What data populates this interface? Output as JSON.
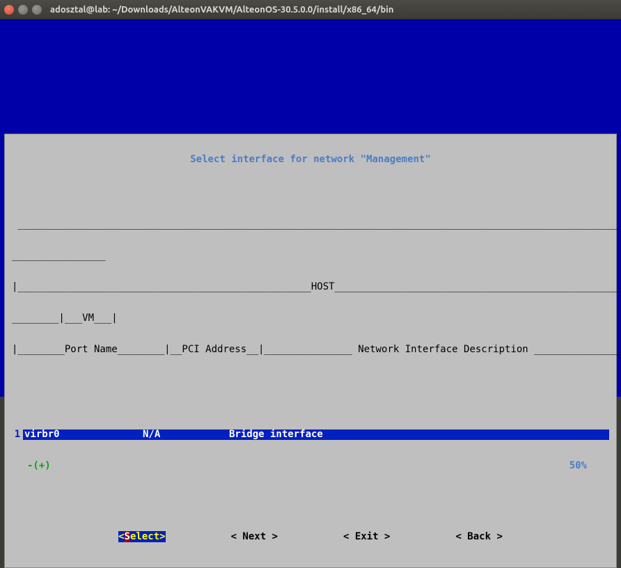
{
  "window": {
    "title": "adosztal@lab: ~/Downloads/AlteonVAKVM/AlteonOS-30.5.0.0/install/x86_64/bin"
  },
  "dialog": {
    "title": " Select interface for network \"Management\" ",
    "header_line1": " ________________________________________________________________________________________________________________",
    "header_line2": "________________",
    "header_host": "|__________________________________________________HOST__________________________________________________________",
    "header_vm": "________|___VM___|",
    "header_cols": "|________Port Name________|__PCI Address__|_______________ Network Interface Description ______________________________|__NUMA__|__Port__|",
    "row": {
      "num": "1",
      "port_name": "virbr0",
      "pci": "N/A",
      "desc": "Bridge interface"
    },
    "plusminus": "-(+)",
    "pct": "50%",
    "buttons": {
      "select_open": "<",
      "select_hot": "S",
      "select_rest": "elect>",
      "next": "< Next >",
      "exit": "< Exit >",
      "back": "< Back >"
    }
  }
}
